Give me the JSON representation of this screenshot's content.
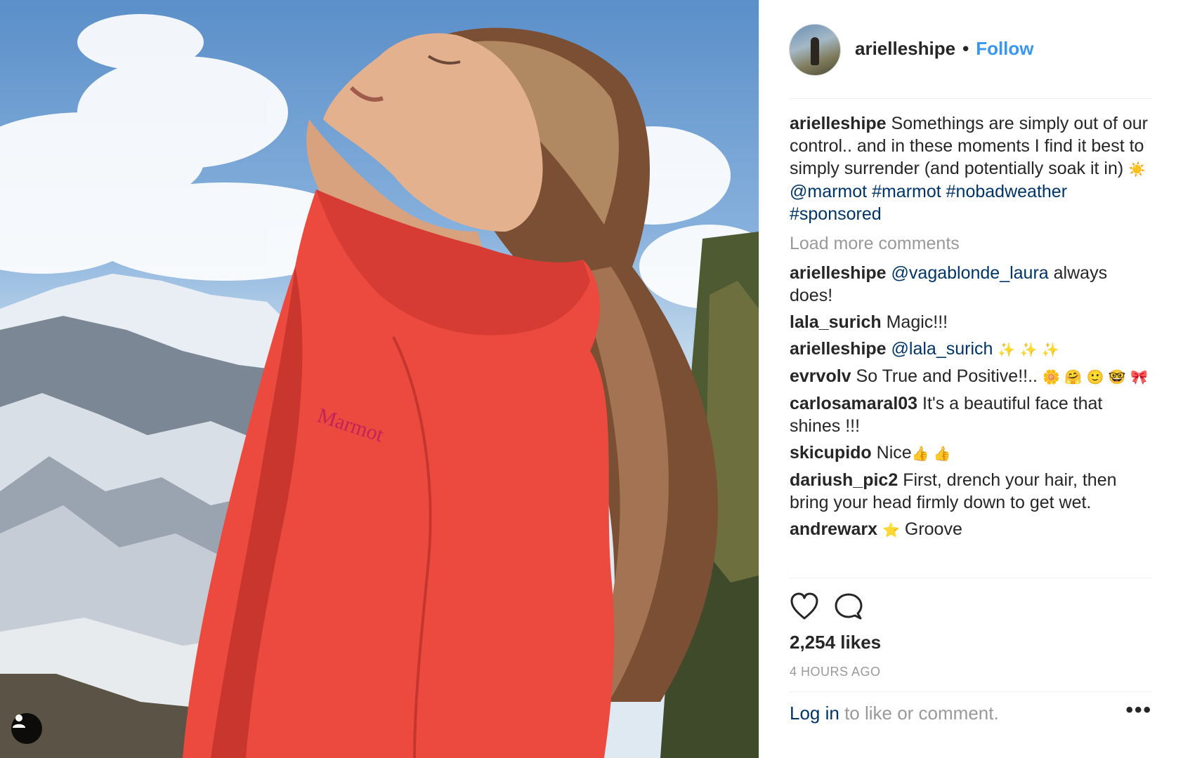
{
  "post": {
    "username": "arielleshipe",
    "follow_label": "Follow",
    "separator": "•",
    "caption": {
      "user": "arielleshipe",
      "text": "Somethings are simply out of our control.. and in these moments I find it best to simply surrender (and potentially soak it in)",
      "emoji": "☀️",
      "mention": "@marmot",
      "tags": [
        "#marmot",
        "#nobadweather",
        "#sponsored"
      ]
    },
    "load_more_label": "Load more comments",
    "comments": [
      {
        "user": "arielleshipe",
        "mention": "@vagablonde_laura",
        "text": "always does!"
      },
      {
        "user": "lala_surich",
        "text": "Magic!!!"
      },
      {
        "user": "arielleshipe",
        "mention": "@lala_surich",
        "emoji": "✨ ✨ ✨"
      },
      {
        "user": "evrvolv",
        "text": "So True and Positive!!..",
        "emoji": "🌼 🤗 🙂 🤓 🎀"
      },
      {
        "user": "carlosamaral03",
        "text": "It's a beautiful face that shines !!!"
      },
      {
        "user": "skicupido",
        "text": "Nice",
        "emoji": "👍 👍"
      },
      {
        "user": "dariush_pic2",
        "text": "First, drench your hair, then bring your head firmly down to get wet."
      },
      {
        "user": "andrewarx",
        "text": "Groove",
        "emoji": "⭐"
      }
    ],
    "likes": "2,254 likes",
    "time": "4 HOURS AGO",
    "footer": {
      "login": "Log in",
      "rest": " to like or comment.",
      "more": "•••"
    },
    "icons": {
      "like": "heart-icon",
      "comment": "comment-icon",
      "tag": "user-tag-icon",
      "options": "more-options-icon"
    },
    "colors": {
      "accent": "#3897f0",
      "link": "#003569",
      "muted": "#999999",
      "jacket": "#ec4a3f"
    }
  }
}
